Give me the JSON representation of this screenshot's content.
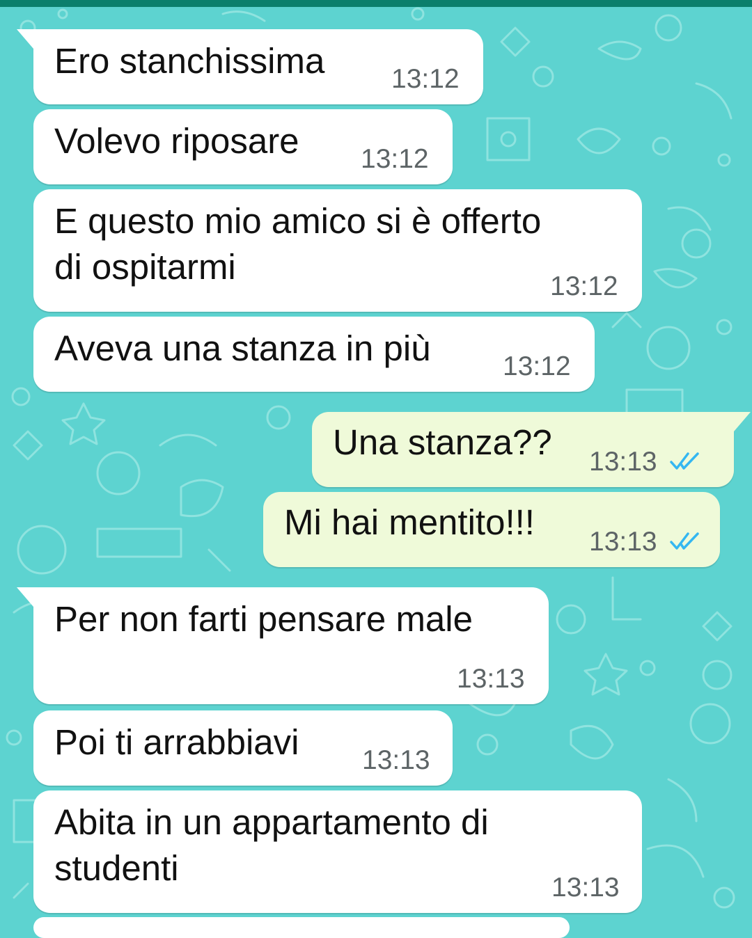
{
  "colors": {
    "wallpaper": "#5dd3d0",
    "incoming_bubble": "#ffffff",
    "outgoing_bubble": "#effad9",
    "read_ticks": "#34b7f1",
    "header": "#0b7f6c"
  },
  "messages": [
    {
      "direction": "incoming",
      "lines": [
        "Ero stanchissima"
      ],
      "time": "13:12"
    },
    {
      "direction": "incoming",
      "lines": [
        "Volevo riposare"
      ],
      "time": "13:12"
    },
    {
      "direction": "incoming",
      "lines": [
        "E questo mio amico si è offerto",
        "di ospitarmi"
      ],
      "time": "13:12"
    },
    {
      "direction": "incoming",
      "lines": [
        "Aveva una stanza in più"
      ],
      "time": "13:12"
    },
    {
      "direction": "outgoing",
      "lines": [
        "Una stanza??"
      ],
      "time": "13:13",
      "status_icon": "double-check-read-icon"
    },
    {
      "direction": "outgoing",
      "lines": [
        "Mi hai mentito!!!"
      ],
      "time": "13:13",
      "status_icon": "double-check-read-icon"
    },
    {
      "direction": "incoming",
      "lines": [
        "Per non farti pensare male"
      ],
      "time": "13:13"
    },
    {
      "direction": "incoming",
      "lines": [
        "Poi ti arrabbiavi"
      ],
      "time": "13:13"
    },
    {
      "direction": "incoming",
      "lines": [
        "Abita in un appartamento di",
        "studenti"
      ],
      "time": "13:13"
    }
  ]
}
